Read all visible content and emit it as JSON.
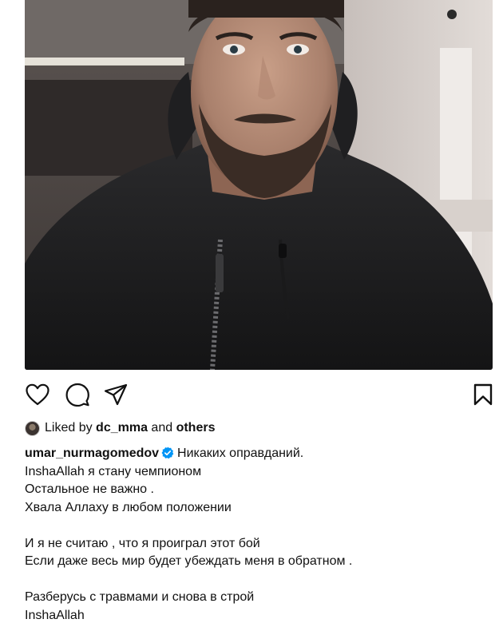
{
  "post": {
    "photo": {
      "subject": "selfie-man-black-jacket"
    },
    "actions": {
      "like_icon": "heart-icon",
      "comment_icon": "comment-icon",
      "share_icon": "share-icon",
      "save_icon": "bookmark-icon"
    },
    "likes": {
      "prefix": "Liked by",
      "user": "dc_mma",
      "conjunction": "and",
      "others": "others"
    },
    "caption": {
      "username": "umar_nurmagomedov",
      "verified_color": "#0095f6",
      "lines": [
        "Никаких оправданий.",
        "InshaAllah я стану чемпионом",
        "Остальное не важно .",
        "Хвала Аллаху в любом положении",
        "",
        "И я не считаю , что я проиграл этот бой",
        "Если даже весь мир будет убеждать меня в обратном .",
        "",
        "Разберусь с травмами и снова в строй",
        "InshaAllah"
      ]
    }
  }
}
